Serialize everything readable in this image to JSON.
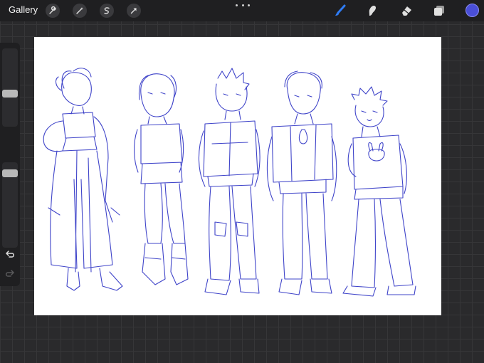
{
  "toolbar": {
    "gallery_label": "Gallery",
    "left_tools": [
      "wrench-icon",
      "magic-wand-icon",
      "selection-icon",
      "transform-arrow-icon"
    ],
    "right_tools": [
      "brush-icon",
      "smudge-icon",
      "eraser-icon",
      "layers-icon"
    ],
    "active_tool": "brush",
    "active_color": "#4a4fd8",
    "accent_color": "#2f7cf6"
  },
  "sidebar": {
    "brush_size_label": "",
    "opacity_label": ""
  },
  "canvas": {
    "background": "#ffffff",
    "sketch_color": "#3f44c9"
  }
}
